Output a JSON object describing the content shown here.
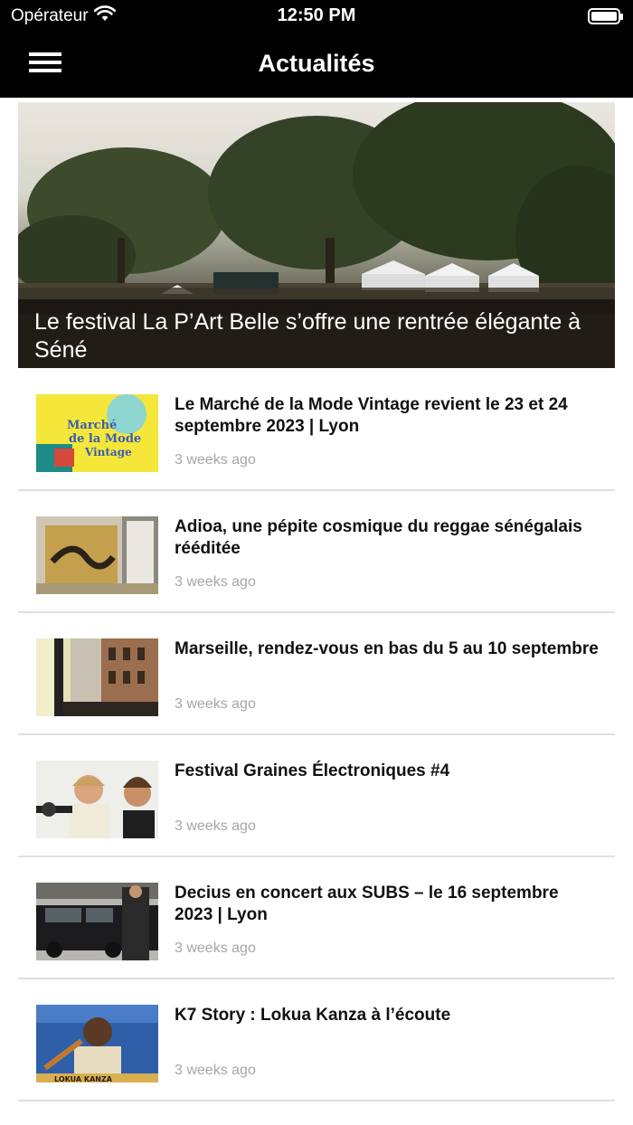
{
  "status_bar": {
    "carrier": "Opérateur",
    "time": "12:50 PM",
    "wifi_icon": "wifi-icon",
    "battery_icon": "battery-icon"
  },
  "nav": {
    "title": "Actualités",
    "menu_icon": "hamburger-menu-icon"
  },
  "hero": {
    "title": "Le festival La P’Art Belle s’offre une rentrée élégante à Séné"
  },
  "articles": [
    {
      "title": "Le Marché de la Mode Vintage revient le 23 et 24 septembre 2023 | Lyon",
      "time": "3 weeks ago"
    },
    {
      "title": "Adioa, une pépite cosmique du reggae sénégalais rééditée",
      "time": "3 weeks ago"
    },
    {
      "title": "Marseille, rendez-vous en bas du 5 au 10 septembre",
      "time": "3 weeks ago"
    },
    {
      "title": "Festival Graines Électroniques #4",
      "time": "3 weeks ago"
    },
    {
      "title": "Decius en concert aux SUBS – le 16 septembre 2023 | Lyon",
      "time": "3 weeks ago"
    },
    {
      "title": "K7 Story : Lokua Kanza à l’écoute",
      "time": "3 weeks ago"
    }
  ],
  "colors": {
    "bar_background": "#000000",
    "meta_text": "#a6a6a6",
    "divider": "#e0e0e0"
  }
}
